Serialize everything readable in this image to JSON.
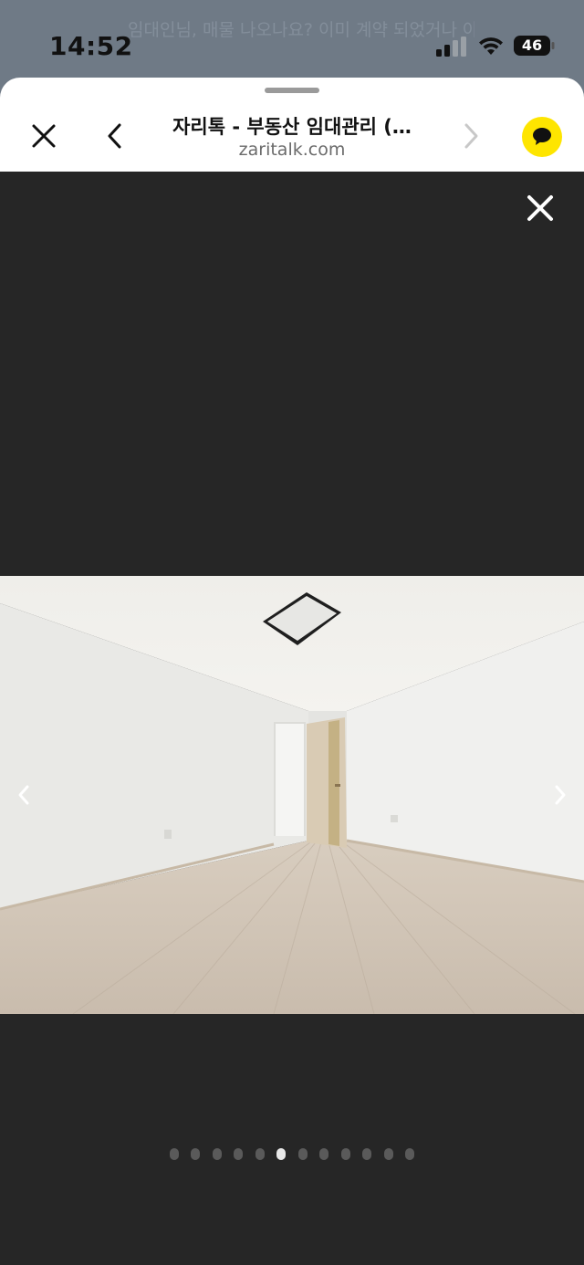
{
  "status_bar": {
    "time": "14:52",
    "battery": "46",
    "background_text": "임대인님, 매물 나오나요? 이미 계약 되었거나 아래 버튼을 눌러 메뉴를 내려주세요",
    "icons": [
      "cellular-signal-icon",
      "wifi-icon",
      "battery-icon"
    ]
  },
  "browser": {
    "title": "자리톡 - 부동산 임대관리 (…",
    "domain": "zaritalk.com",
    "icons": [
      "close-icon",
      "chevron-left-icon",
      "chevron-right-icon",
      "kakaotalk-icon"
    ]
  },
  "viewer": {
    "image_alt": "",
    "icons": [
      "close-viewer-icon",
      "prev-arrow-icon",
      "next-arrow-icon"
    ],
    "page_count": 12,
    "active_index": 5
  },
  "colors": {
    "viewer_bg": "#262626",
    "kakao_yellow": "#fee500",
    "dot_inactive": "#5a5a5a",
    "dot_active": "#e8e8e8"
  }
}
